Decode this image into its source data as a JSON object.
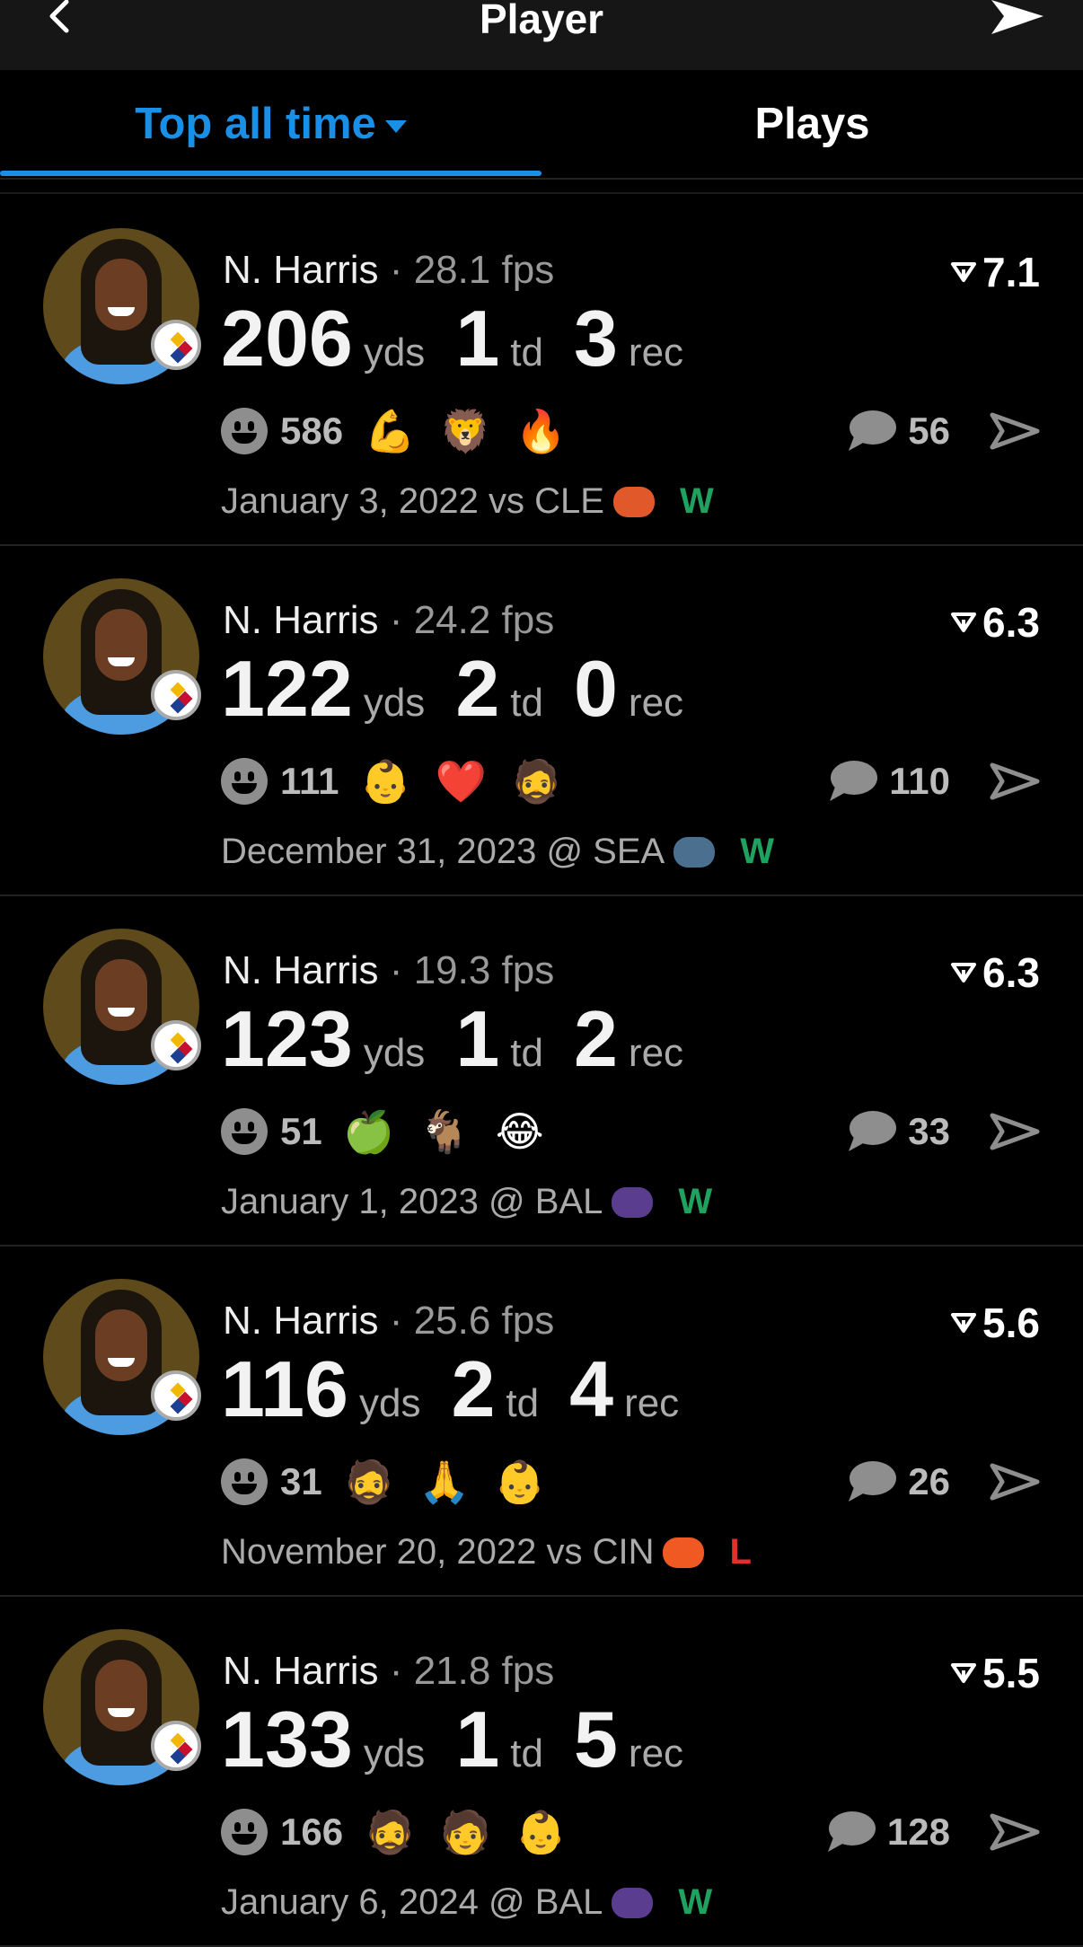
{
  "header": {
    "title": "Player"
  },
  "tabs": [
    {
      "label": "Top all time",
      "active": true
    },
    {
      "label": "Plays",
      "active": false
    }
  ],
  "colors": {
    "accent": "#1a8fe6",
    "win": "#1fa260",
    "loss": "#e5302a",
    "background": "#000000"
  },
  "plays": [
    {
      "player": "N. Harris",
      "sep": "·",
      "fps": "28.1 fps",
      "score": "7.1",
      "yds": "206",
      "yds_unit": "yds",
      "td": "1",
      "td_unit": "td",
      "rec": "3",
      "rec_unit": "rec",
      "reactions": "586",
      "emojis": [
        "💪",
        "🦁",
        "🔥"
      ],
      "comments": "56",
      "date": "January 3, 2022",
      "venue": "vs CLE",
      "opp_logo": "browns-helmet",
      "opp_color": "#e1582a",
      "result": "W"
    },
    {
      "player": "N. Harris",
      "sep": "·",
      "fps": "24.2 fps",
      "score": "6.3",
      "yds": "122",
      "yds_unit": "yds",
      "td": "2",
      "td_unit": "td",
      "rec": "0",
      "rec_unit": "rec",
      "reactions": "111",
      "emojis": [
        "👶",
        "❤️",
        "🧔"
      ],
      "comments": "110",
      "date": "December 31, 2023",
      "venue": "@ SEA",
      "opp_logo": "seahawks-logo",
      "opp_color": "#4a6f8f",
      "result": "W"
    },
    {
      "player": "N. Harris",
      "sep": "·",
      "fps": "19.3 fps",
      "score": "6.3",
      "yds": "123",
      "yds_unit": "yds",
      "td": "1",
      "td_unit": "td",
      "rec": "2",
      "rec_unit": "rec",
      "reactions": "51",
      "emojis": [
        "🍏",
        "🐐",
        "😂"
      ],
      "comments": "33",
      "date": "January 1, 2023",
      "venue": "@ BAL",
      "opp_logo": "ravens-logo",
      "opp_color": "#5a3d8f",
      "result": "W"
    },
    {
      "player": "N. Harris",
      "sep": "·",
      "fps": "25.6 fps",
      "score": "5.6",
      "yds": "116",
      "yds_unit": "yds",
      "td": "2",
      "td_unit": "td",
      "rec": "4",
      "rec_unit": "rec",
      "reactions": "31",
      "emojis": [
        "🧔",
        "🙏",
        "👶"
      ],
      "comments": "26",
      "date": "November 20, 2022",
      "venue": "vs CIN",
      "opp_logo": "bengals-logo",
      "opp_color": "#f05a22",
      "result": "L"
    },
    {
      "player": "N. Harris",
      "sep": "·",
      "fps": "21.8 fps",
      "score": "5.5",
      "yds": "133",
      "yds_unit": "yds",
      "td": "1",
      "td_unit": "td",
      "rec": "5",
      "rec_unit": "rec",
      "reactions": "166",
      "emojis": [
        "🧔",
        "🧑",
        "👶"
      ],
      "comments": "128",
      "date": "January 6, 2024",
      "venue": "@ BAL",
      "opp_logo": "ravens-logo",
      "opp_color": "#5a3d8f",
      "result": "W"
    }
  ]
}
